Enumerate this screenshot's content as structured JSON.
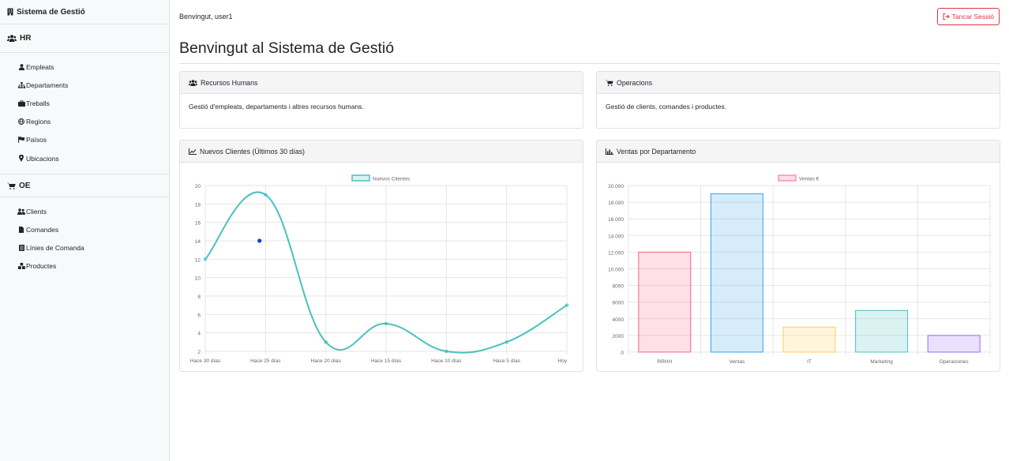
{
  "sidebar": {
    "brand": "Sistema de Gestió",
    "sections": [
      {
        "title": "HR",
        "items": [
          "Empleats",
          "Departaments",
          "Treballs",
          "Regions",
          "Països",
          "Ubicacions"
        ]
      },
      {
        "title": "OE",
        "items": [
          "Clients",
          "Comandes",
          "Línies de Comanda",
          "Productes"
        ]
      }
    ]
  },
  "header": {
    "welcome": "Benvingut, user1",
    "logout_label": "Tancar Sessió",
    "title": "Benvingut al Sistema de Gestió"
  },
  "cards": {
    "hr": {
      "title": "Recursos Humans",
      "text": "Gestió d'empleats, departaments i altres recursos humans."
    },
    "oe": {
      "title": "Operacions",
      "text": "Gestió de clients, comandes i productes."
    },
    "clients_chart": {
      "title": "Nuevos Clientes (Últimos 30 días)"
    },
    "sales_chart": {
      "title": "Ventas por Departamento"
    }
  },
  "colors": {
    "line": "#4bc0c0",
    "danger": "#dc3545",
    "highlight_point": "#0d47c4"
  },
  "chart_data": [
    {
      "type": "line",
      "x": [
        "Hace 30 días",
        "Hace 25 días",
        "Hace 20 días",
        "Hace 15 días",
        "Hace 10 días",
        "Hace 5 días",
        "Hoy"
      ],
      "series": [
        {
          "name": "Nuevos Clientes",
          "values": [
            12,
            19,
            3,
            5,
            2,
            3,
            7
          ],
          "color": "#4bc0c0"
        }
      ],
      "highlighted_point": {
        "x": 25.5,
        "y": 14
      },
      "y_ticks": [
        "2",
        "4",
        "6",
        "8",
        "10",
        "12",
        "14",
        "16",
        "18",
        "20"
      ],
      "ylim": [
        2,
        20
      ],
      "legend": "top",
      "grid": true
    },
    {
      "type": "bar",
      "categories": [
        "RRHH",
        "Ventas",
        "IT",
        "Marketing",
        "Operaciones"
      ],
      "series": [
        {
          "name": "Ventas €",
          "values": [
            12000,
            19000,
            3000,
            5000,
            2000
          ]
        }
      ],
      "bar_colors": [
        "#ff6384",
        "#36a2eb",
        "#ffce56",
        "#4bc0c0",
        "#9966ff"
      ],
      "y_ticks": [
        "0",
        "2000",
        "4000",
        "6000",
        "8000",
        "10.000",
        "12.000",
        "14.000",
        "16.000",
        "18.000",
        "20.000"
      ],
      "ylim": [
        0,
        20000
      ],
      "legend": "top",
      "grid": true
    }
  ]
}
